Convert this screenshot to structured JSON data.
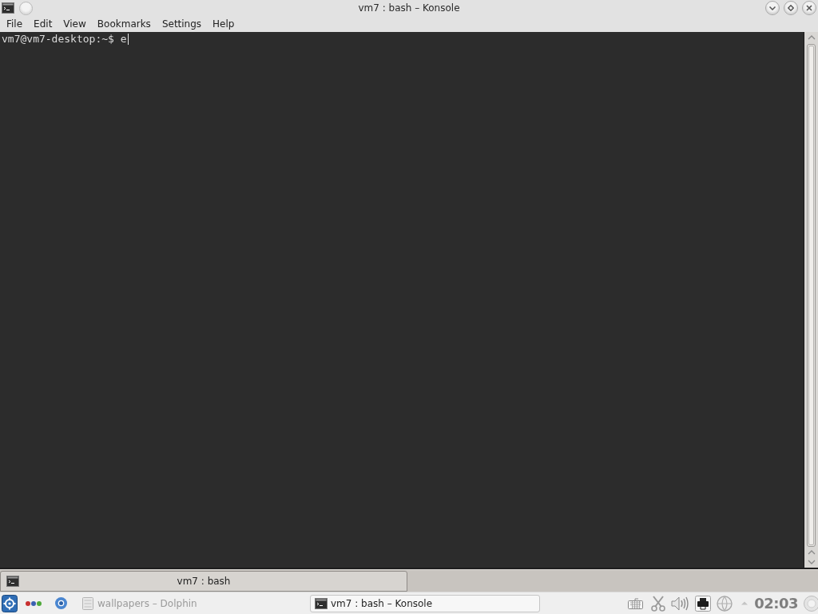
{
  "window": {
    "title": "vm7 : bash – Konsole"
  },
  "menu": [
    "File",
    "Edit",
    "View",
    "Bookmarks",
    "Settings",
    "Help"
  ],
  "terminal": {
    "lines": [
      "vm7@vm7-desktop:~$ e"
    ]
  },
  "tabs": [
    {
      "label": "vm7 : bash",
      "selected": true
    }
  ],
  "taskbar": {
    "tasks": [
      {
        "label": "wallpapers – Dolphin",
        "selected": false
      },
      {
        "label": "vm7 : bash – Konsole",
        "selected": true
      }
    ],
    "clock": "02:03"
  }
}
